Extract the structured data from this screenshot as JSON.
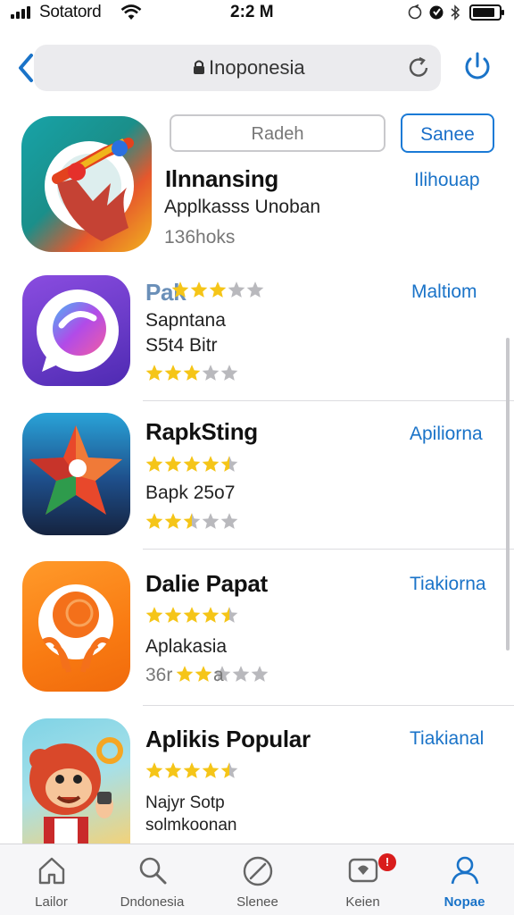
{
  "status_bar": {
    "carrier": "Sotatord",
    "time": "2:2 M"
  },
  "address_bar": {
    "url": "Inoponesia"
  },
  "featured": {
    "search_placeholder": "Radeh",
    "save_label": "Sanee",
    "title": "Ilnnansing",
    "subtitle": "Applkasss Unoban",
    "meta": "136hoks",
    "action": "Ilihouap"
  },
  "apps": [
    {
      "title": "Pak",
      "line1": "Sapntana",
      "line2": "S5t4 Bitr",
      "action": "Maltiom",
      "title_stars": 3,
      "rating": 3
    },
    {
      "title": "RapkSting",
      "line1": "Bapk 25o7",
      "action": "Apiliorna",
      "rating_top": 4.5,
      "rating": 2.5
    },
    {
      "title": "Dalie Papat",
      "line1": "Aplakasia",
      "line2": "36r",
      "line2_suffix": "a",
      "action": "Tiakiorna",
      "rating_top": 4.5,
      "rating": 2
    },
    {
      "title": "Aplikis Popular",
      "line1": "Najyr Sotp",
      "line2": "solmkoonan",
      "action": "Tiakianal",
      "rating_top": 4.5
    }
  ],
  "tab_bar": {
    "tabs": [
      {
        "label": "Lailor",
        "icon": "home-icon"
      },
      {
        "label": "Dndonesia",
        "icon": "search-icon"
      },
      {
        "label": "Slenee",
        "icon": "compass-icon"
      },
      {
        "label": "Keien",
        "icon": "updates-icon"
      },
      {
        "label": "Nopae",
        "icon": "person-icon"
      }
    ],
    "badge_label": "!"
  },
  "colors": {
    "accent": "#1a73c8",
    "star": "#f5c518",
    "star_empty": "#b9b9bd",
    "badge": "#d91c1c"
  }
}
